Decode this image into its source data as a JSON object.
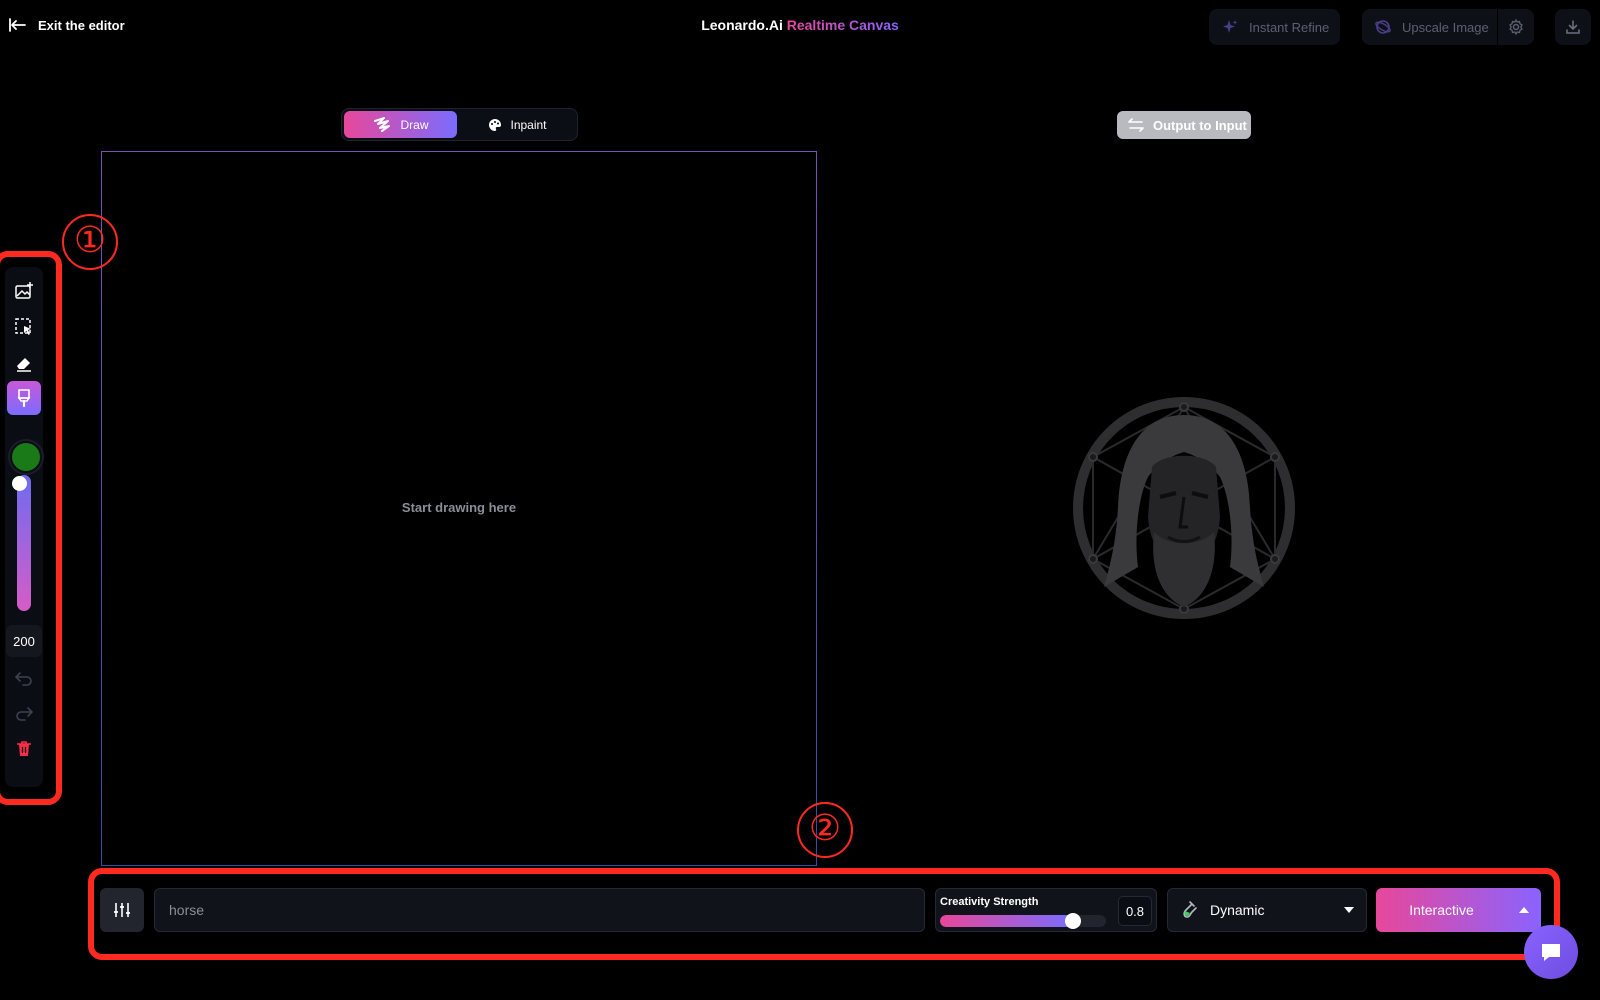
{
  "topbar": {
    "exit_label": "Exit the editor",
    "title_brand": "Leonardo.Ai",
    "title_sub": "Realtime Canvas",
    "instant_refine_label": "Instant Refine",
    "upscale_label": "Upscale Image"
  },
  "mode_toggle": {
    "draw_label": "Draw",
    "inpaint_label": "Inpaint",
    "active": "Draw"
  },
  "output_to_input_label": "Output to Input",
  "canvas": {
    "hint": "Start drawing here"
  },
  "toolbar": {
    "tools": [
      "image-upload-icon",
      "select-icon",
      "eraser-icon",
      "brush-icon",
      "undo-icon",
      "redo-icon",
      "trash-icon"
    ],
    "active_tool": "brush-icon",
    "brush_color": "#1a7a18",
    "brush_size": "200"
  },
  "annotations": {
    "marker_1": "①",
    "marker_2": "②"
  },
  "bottom": {
    "prompt_value": "horse",
    "creativity_label": "Creativity Strength",
    "creativity_value": "0.8",
    "creativity_fraction": 0.8,
    "style_value": "Dynamic",
    "mode_value": "Interactive"
  },
  "colors": {
    "accent_pink": "#e8479a",
    "accent_purple": "#7a6cff",
    "annotation_red": "#ff2a1f"
  }
}
